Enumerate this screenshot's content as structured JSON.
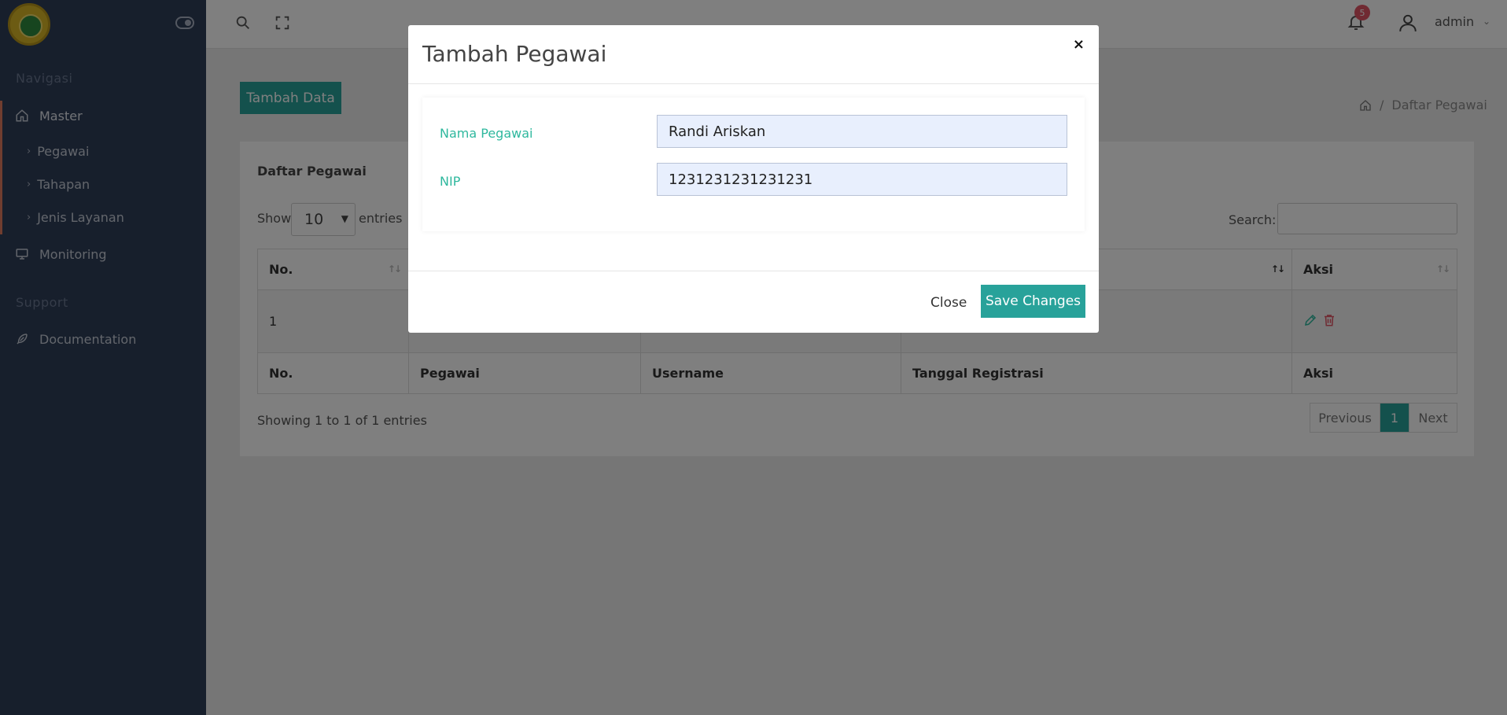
{
  "sidebar": {
    "section_nav": "Navigasi",
    "master_label": "Master",
    "sub_items": [
      "Pegawai",
      "Tahapan",
      "Jenis Layanan"
    ],
    "monitoring_label": "Monitoring",
    "section_support": "Support",
    "documentation_label": "Documentation"
  },
  "header": {
    "notification_count": "5",
    "user_name": "admin"
  },
  "page": {
    "add_button": "Tambah Data",
    "breadcrumb_current": "Daftar Pegawai",
    "breadcrumb_sep": "/"
  },
  "table": {
    "title": "Daftar Pegawai",
    "show_label": "Show",
    "page_size": "10",
    "entries_label": "entries",
    "search_label": "Search:",
    "columns": [
      "No.",
      "Pegawai",
      "Username",
      "Tanggal Registrasi",
      "Aksi"
    ],
    "rows": [
      {
        "no": "1",
        "pegawai": "",
        "username": "",
        "tanggal": ""
      }
    ],
    "info": "Showing 1 to 1 of 1 entries",
    "pagination": {
      "previous": "Previous",
      "current": "1",
      "next": "Next"
    }
  },
  "modal": {
    "title": "Tambah Pegawai",
    "close_x": "×",
    "nama_label": "Nama Pegawai",
    "nama_value": "Randi Ariskan",
    "nip_label": "NIP",
    "nip_value": "1231231231231231",
    "close_button": "Close",
    "save_button": "Save Changes"
  },
  "colors": {
    "sidebar_bg": "#2e3e58",
    "accent": "#28a29a",
    "label_green": "#2fb89e",
    "badge_red": "#e05565"
  }
}
